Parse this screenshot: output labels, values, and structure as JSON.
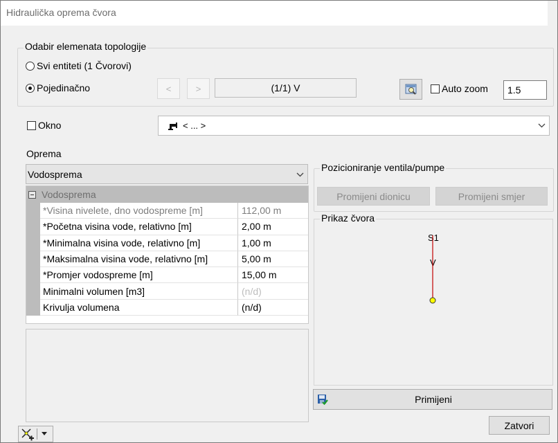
{
  "window": {
    "title": "Hidraulička oprema čvora"
  },
  "topology": {
    "legend": "Odabir elemenata topologije",
    "all_entities_label": "Svi entiteti (1 Čvorovi)",
    "individual_label": "Pojedinačno",
    "selected_mode": "individual",
    "prev_glyph": "<",
    "next_glyph": ">",
    "counter_text": "(1/1)  V",
    "auto_zoom_label": "Auto zoom",
    "auto_zoom_checked": false,
    "auto_zoom_value": "1.5"
  },
  "okno": {
    "label": "Okno",
    "checked": false,
    "combo_value": "< ... >"
  },
  "oprema": {
    "label": "Oprema",
    "selected": "Vodosprema",
    "grid": {
      "category": "Vodosprema",
      "rows": [
        {
          "name": "*Visina nivelete, dno vodospreme [m]",
          "value": "112,00 m",
          "style": "muted"
        },
        {
          "name": "*Početna visina vode, relativno [m]",
          "value": "2,00 m",
          "style": "normal"
        },
        {
          "name": "*Minimalna visina vode, relativno [m]",
          "value": "1,00 m",
          "style": "normal"
        },
        {
          "name": "*Maksimalna visina vode, relativno [m]",
          "value": "5,00 m",
          "style": "normal"
        },
        {
          "name": "*Promjer vodospreme [m]",
          "value": "15,00 m",
          "style": "normal"
        },
        {
          "name": "Minimalni volumen [m3]",
          "value": "(n/d)",
          "style": "faint"
        },
        {
          "name": "Krivulja volumena",
          "value": "(n/d)",
          "style": "normal"
        }
      ]
    }
  },
  "positioning": {
    "legend": "Pozicioniranje ventila/pumpe",
    "change_section_label": "Promijeni dionicu",
    "change_direction_label": "Promijeni smjer"
  },
  "preview": {
    "legend": "Prikaz čvora",
    "node_top_label": "S1",
    "node_mid_label": "V",
    "line_color": "#c00000",
    "node_color": "#ffff00"
  },
  "actions": {
    "apply_label": "Primijeni",
    "close_label": "Zatvori"
  }
}
